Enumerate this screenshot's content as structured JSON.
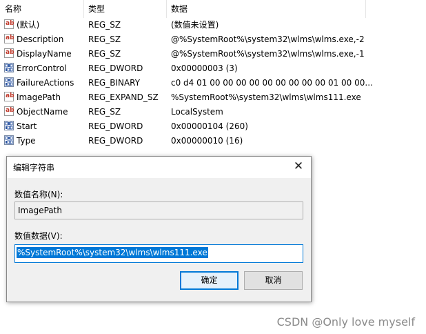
{
  "columns": {
    "name": "名称",
    "type": "类型",
    "data": "数据"
  },
  "rows": [
    {
      "icon": "string-value-icon",
      "name": "(默认)",
      "type": "REG_SZ",
      "data": "(数值未设置)"
    },
    {
      "icon": "string-value-icon",
      "name": "Description",
      "type": "REG_SZ",
      "data": "@%SystemRoot%\\system32\\wlms\\wlms.exe,-2"
    },
    {
      "icon": "string-value-icon",
      "name": "DisplayName",
      "type": "REG_SZ",
      "data": "@%SystemRoot%\\system32\\wlms\\wlms.exe,-1"
    },
    {
      "icon": "binary-value-icon",
      "name": "ErrorControl",
      "type": "REG_DWORD",
      "data": "0x00000003 (3)"
    },
    {
      "icon": "binary-value-icon",
      "name": "FailureActions",
      "type": "REG_BINARY",
      "data": "c0 d4 01 00 00 00 00 00 00 00 00 00 01 00 00..."
    },
    {
      "icon": "string-value-icon",
      "name": "ImagePath",
      "type": "REG_EXPAND_SZ",
      "data": "%SystemRoot%\\system32\\wlms\\wlms111.exe"
    },
    {
      "icon": "string-value-icon",
      "name": "ObjectName",
      "type": "REG_SZ",
      "data": "LocalSystem"
    },
    {
      "icon": "binary-value-icon",
      "name": "Start",
      "type": "REG_DWORD",
      "data": "0x00000104 (260)"
    },
    {
      "icon": "binary-value-icon",
      "name": "Type",
      "type": "REG_DWORD",
      "data": "0x00000010 (16)"
    }
  ],
  "dialog": {
    "title": "编辑字符串",
    "close_symbol": "✕",
    "value_name_label": "数值名称(N):",
    "value_name": "ImagePath",
    "value_data_label": "数值数据(V):",
    "value_data": "%SystemRoot%\\system32\\wlms\\wlms111.exe",
    "ok_label": "确定",
    "cancel_label": "取消"
  },
  "watermark": "CSDN @Only love myself"
}
